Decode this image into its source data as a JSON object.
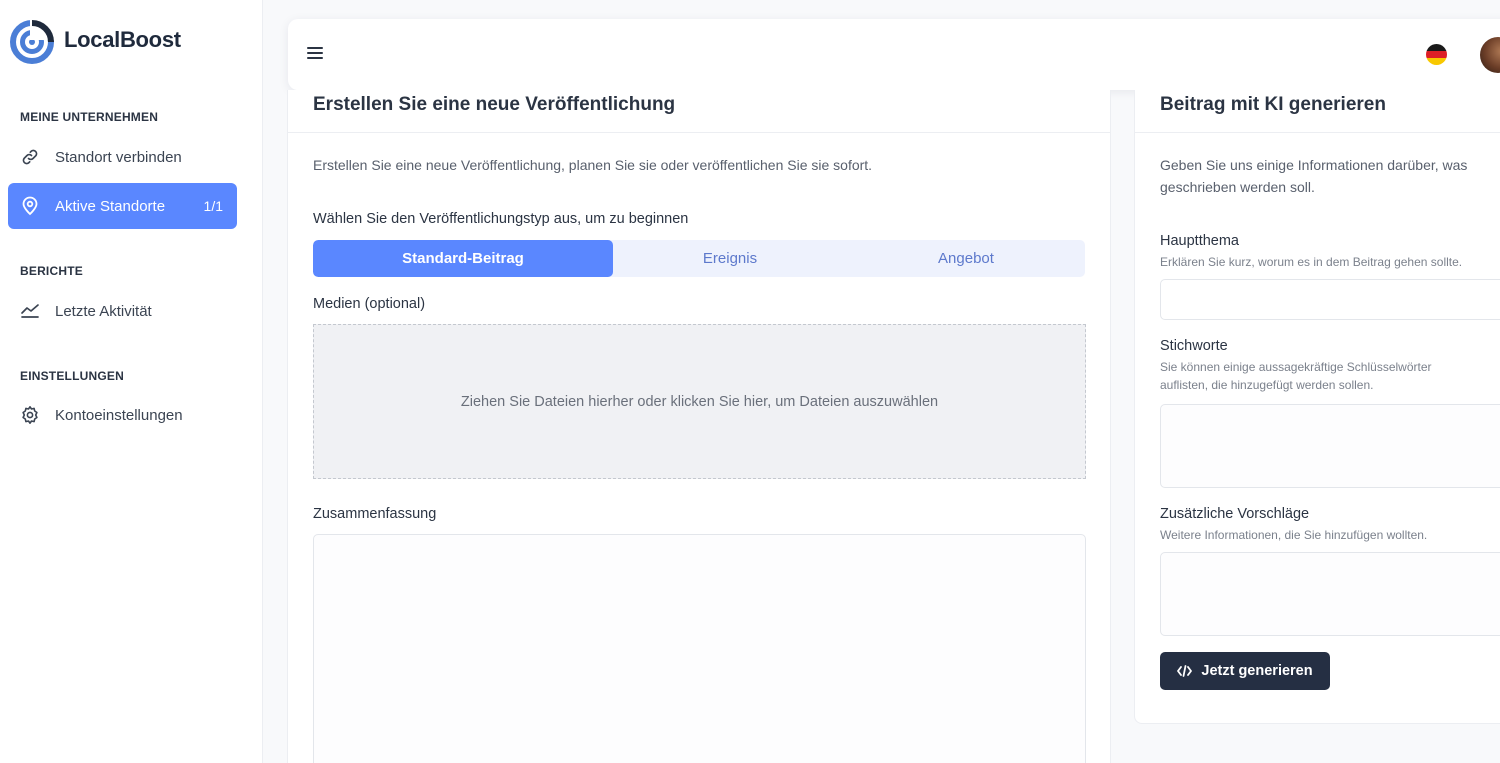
{
  "brand": {
    "name": "LocalBoost",
    "logo_icon": "target-logo-icon",
    "accent": "#5a87ff"
  },
  "sidebar": {
    "sections": [
      {
        "title": "MEINE UNTERNEHMEN"
      },
      {
        "title": "BERICHTE"
      },
      {
        "title": "EINSTELLUNGEN"
      }
    ],
    "items": [
      {
        "label": "Standort verbinden",
        "icon": "link-icon"
      },
      {
        "label": "Aktive Standorte",
        "icon": "map-pin-icon",
        "badge": "1/1",
        "active": true
      },
      {
        "label": "Letzte Aktivität",
        "icon": "activity-chart-icon"
      },
      {
        "label": "Kontoeinstellungen",
        "icon": "gear-icon"
      }
    ]
  },
  "topbar": {
    "menu_icon": "hamburger-menu-icon",
    "language_icon": "german-flag-icon",
    "avatar_icon": "user-avatar"
  },
  "create_post": {
    "title": "Erstellen Sie eine neue Veröffentlichung",
    "description": "Erstellen Sie eine neue Veröffentlichung, planen Sie sie oder veröffentlichen Sie sie sofort.",
    "type_label": "Wählen Sie den Veröffentlichungstyp aus, um zu beginnen",
    "tabs": [
      {
        "label": "Standard-Beitrag",
        "active": true
      },
      {
        "label": "Ereignis"
      },
      {
        "label": "Angebot"
      }
    ],
    "media_label": "Medien (optional)",
    "dropzone_text": "Ziehen Sie Dateien hierher oder klicken Sie hier, um Dateien auszuwählen",
    "summary_label": "Zusammenfassung",
    "summary_value": ""
  },
  "ai_generate": {
    "title": "Beitrag mit KI generieren",
    "description": "Geben Sie uns einige Informationen darüber, was geschrieben werden soll.",
    "main_topic": {
      "label": "Hauptthema",
      "hint": "Erklären Sie kurz, worum es in dem Beitrag gehen sollte.",
      "value": ""
    },
    "keywords": {
      "label": "Stichworte",
      "hint": "Sie können einige aussagekräftige Schlüsselwörter auflisten, die hinzugefügt werden sollen.",
      "value": ""
    },
    "suggestions": {
      "label": "Zusätzliche Vorschläge",
      "hint": "Weitere Informationen, die Sie hinzufügen wollten.",
      "value": ""
    },
    "button_label": "Jetzt generieren",
    "button_icon": "code-icon"
  }
}
